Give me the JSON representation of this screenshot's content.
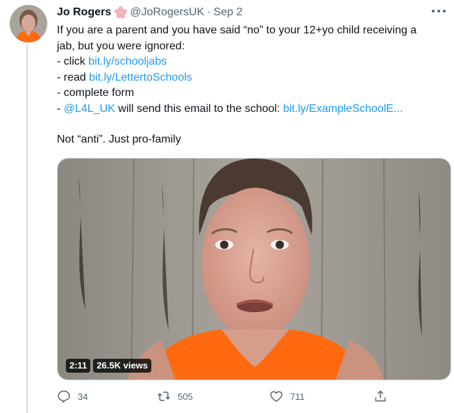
{
  "tweet": {
    "display_name": "Jo Rogers",
    "handle": "@JoRogersUK",
    "separator": "·",
    "date": "Sep 2",
    "text": {
      "line1": "If you are a parent and you have said “no” to your 12+yo child receiving a",
      "line2": "jab, but you were ignored:",
      "line3_prefix": "- click ",
      "line3_link": "bit.ly/schooljabs",
      "line4_prefix": "- read ",
      "line4_link": "bit.ly/LettertoSchools",
      "line5": "- complete form",
      "line6_prefix": "- ",
      "line6_mention": "@L4L_UK",
      "line6_middle": " will send this email to the school: ",
      "line6_link": "bit.ly/ExampleSchoolE...",
      "line7": "Not “anti”. Just pro-family"
    },
    "media": {
      "duration": "2:11",
      "views": "26.5K views"
    },
    "actions": {
      "replies": "34",
      "retweets": "505",
      "likes": "711"
    }
  },
  "colors": {
    "link": "#1d9bf0",
    "secondary_text": "#536471",
    "primary_text": "#0f1419",
    "shirt": "#ff6a10"
  },
  "icons": [
    "flower-emoji-icon",
    "more-icon",
    "reply-icon",
    "retweet-icon",
    "like-icon",
    "share-icon"
  ]
}
